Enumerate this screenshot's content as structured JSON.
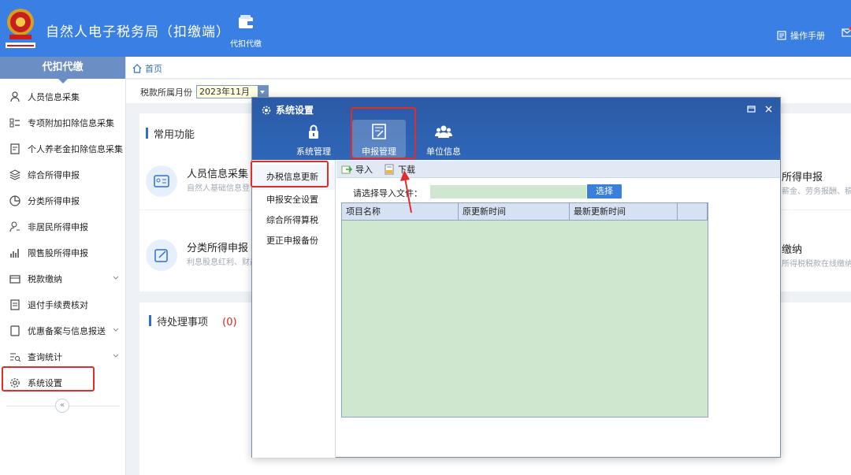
{
  "header": {
    "app_title": "自然人电子税务局（扣缴端）",
    "nav_tab_label": "代扣代缴",
    "manual_label": "操作手册",
    "emblem_icon": "tax-emblem-icon"
  },
  "sidebar": {
    "title": "代扣代缴",
    "items": [
      {
        "label": "人员信息采集",
        "icon": "person-icon",
        "expandable": false
      },
      {
        "label": "专项附加扣除信息采集",
        "icon": "list-icon",
        "expandable": false
      },
      {
        "label": "个人养老金扣除信息采集",
        "icon": "document-icon",
        "expandable": false
      },
      {
        "label": "综合所得申报",
        "icon": "layers-icon",
        "expandable": false
      },
      {
        "label": "分类所得申报",
        "icon": "pie-icon",
        "expandable": false
      },
      {
        "label": "非居民所得申报",
        "icon": "user-minus-icon",
        "expandable": false
      },
      {
        "label": "限售股所得申报",
        "icon": "bar-chart-icon",
        "expandable": false
      },
      {
        "label": "税款缴纳",
        "icon": "wallet-icon",
        "expandable": true
      },
      {
        "label": "退付手续费核对",
        "icon": "checklist-icon",
        "expandable": false
      },
      {
        "label": "优惠备案与信息报送",
        "icon": "file-icon",
        "expandable": true
      },
      {
        "label": "查询统计",
        "icon": "search-list-icon",
        "expandable": true
      },
      {
        "label": "系统设置",
        "icon": "gear-icon",
        "expandable": false
      }
    ],
    "collapse_label": "«"
  },
  "breadcrumb": {
    "home": "首页"
  },
  "filter": {
    "label": "税款所属月份",
    "value": "2023年11月"
  },
  "common_functions": {
    "title": "常用功能",
    "items": [
      {
        "name": "人员信息采集",
        "desc": "自然人基础信息登",
        "icon": "id-card-icon"
      },
      {
        "name": "分类所得申报",
        "desc": "利息股息红利、财产",
        "icon": "edit-icon"
      },
      {
        "name": "所得申报",
        "desc": "薪金、劳务报酬、稿",
        "icon": ""
      },
      {
        "name": "缴纳",
        "desc": "所得税税款在线缴纳",
        "icon": ""
      }
    ]
  },
  "pending": {
    "title": "待处理事项",
    "count": "(0)"
  },
  "modal": {
    "title": "系统设置",
    "tabs": [
      {
        "label": "系统管理",
        "icon": "lock-icon",
        "active": false
      },
      {
        "label": "申报管理",
        "icon": "form-edit-icon",
        "active": true
      },
      {
        "label": "单位信息",
        "icon": "group-icon",
        "active": false
      }
    ],
    "left_menu": [
      "办税信息更新",
      "申报安全设置",
      "综合所得算税",
      "更正申报备份"
    ],
    "toolbar": {
      "import_label": "导入",
      "download_label": "下载"
    },
    "file": {
      "label": "请选择导入文件：",
      "value": "",
      "button": "选择"
    },
    "grid_columns": [
      "项目名称",
      "原更新时间",
      "最新更新时间",
      ""
    ],
    "grid_rows": []
  },
  "colors": {
    "header_blue": "#3a7fe3",
    "modal_blue": "#2f66b8",
    "grid_green": "#cfe6cf",
    "highlight_red": "#e12c2c"
  }
}
